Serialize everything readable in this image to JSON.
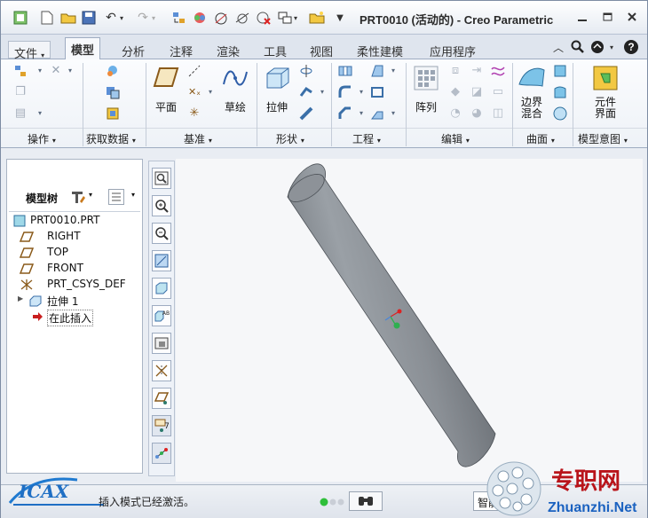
{
  "window": {
    "title": "PRT0010 (活动的) - Creo Parametric"
  },
  "quick_access": [
    "window-icon",
    "new-icon",
    "open-icon",
    "save-icon",
    "undo-icon",
    "redo-icon",
    "regenerate-icon",
    "render-icon",
    "measure-icon",
    "delete-icon",
    "window-switch-icon",
    "folder-icon",
    "customize-icon"
  ],
  "tabs": {
    "file": "文件",
    "items": [
      "模型",
      "分析",
      "注释",
      "渲染",
      "工具",
      "视图",
      "柔性建模",
      "应用程序"
    ]
  },
  "ribbon": {
    "groups": [
      "操作",
      "获取数据",
      "基准",
      "形状",
      "工程",
      "编辑",
      "曲面",
      "模型意图"
    ],
    "big_buttons": {
      "plane": "平面",
      "sketch": "草绘",
      "extrude": "拉伸",
      "pattern": "阵列",
      "boundary_blend_1": "边界",
      "boundary_blend_2": "混合",
      "component_interface_1": "元件",
      "component_interface_2": "界面"
    }
  },
  "panel": {
    "header": "模型树",
    "tree": [
      {
        "label": "PRT0010.PRT",
        "icon": "part-icon"
      },
      {
        "label": "RIGHT",
        "icon": "datum-plane-icon"
      },
      {
        "label": "TOP",
        "icon": "datum-plane-icon"
      },
      {
        "label": "FRONT",
        "icon": "datum-plane-icon"
      },
      {
        "label": "PRT_CSYS_DEF",
        "icon": "coordinate-system-icon"
      },
      {
        "label": "拉伸 1",
        "icon": "extrude-icon"
      },
      {
        "label": "在此插入",
        "icon": "insert-here-arrow-icon"
      }
    ]
  },
  "view_toolbar": [
    "refit-icon",
    "zoom-in-icon",
    "zoom-out-icon",
    "repaint-icon",
    "display-style-icon",
    "saved-views-icon",
    "view-manager-icon",
    "datum-display-icon",
    "spin-center-icon",
    "annotation-display-icon",
    "plane-display-icon",
    "csys-display-icon"
  ],
  "status": {
    "message": "插入模式已经激活。",
    "filter": "智能"
  },
  "watermarks": {
    "left": "ICAX",
    "right_cn": "专职网",
    "right_en": "Zhuanzhi.Net"
  },
  "colors": {
    "cylinder": "#878c92",
    "graphics_bg": "#f6f7f9",
    "active_tab": "#f7f9fc"
  }
}
